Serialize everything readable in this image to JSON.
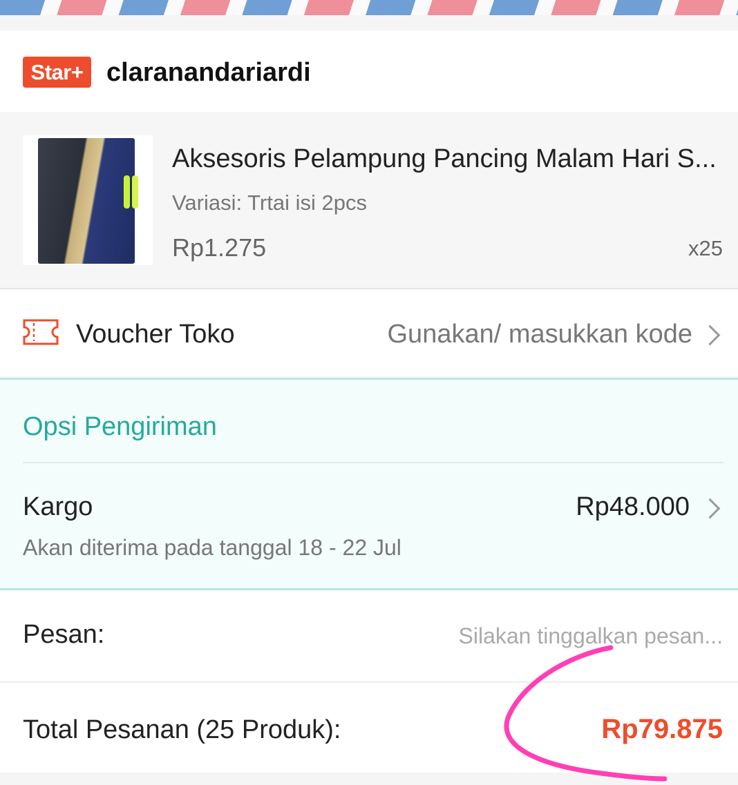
{
  "colors": {
    "brand": "#ee4d2d",
    "accent_teal": "#26aa99",
    "annotation": "#ff3fb4",
    "airmail_blue": "#6f9fd4",
    "airmail_red": "#ef8f9a"
  },
  "shop": {
    "badge": "Star+",
    "name": "claranandariardi"
  },
  "product": {
    "title": "Aksesoris Pelampung Pancing Malam Hari S...",
    "variant": "Variasi: Trtai isi 2pcs",
    "price": "Rp1.275",
    "quantity": "x25",
    "image_icon": "product-thumbnail"
  },
  "voucher": {
    "icon": "ticket-icon",
    "label": "Voucher Toko",
    "action": "Gunakan/ masukkan kode"
  },
  "shipping": {
    "title": "Opsi Pengiriman",
    "courier": "Kargo",
    "cost": "Rp48.000",
    "eta": "Akan diterima pada tanggal 18 - 22 Jul"
  },
  "message": {
    "label": "Pesan:",
    "placeholder": "Silakan tinggalkan pesan...",
    "value": ""
  },
  "order_total": {
    "label": "Total Pesanan (25 Produk):",
    "value": "Rp79.875"
  }
}
